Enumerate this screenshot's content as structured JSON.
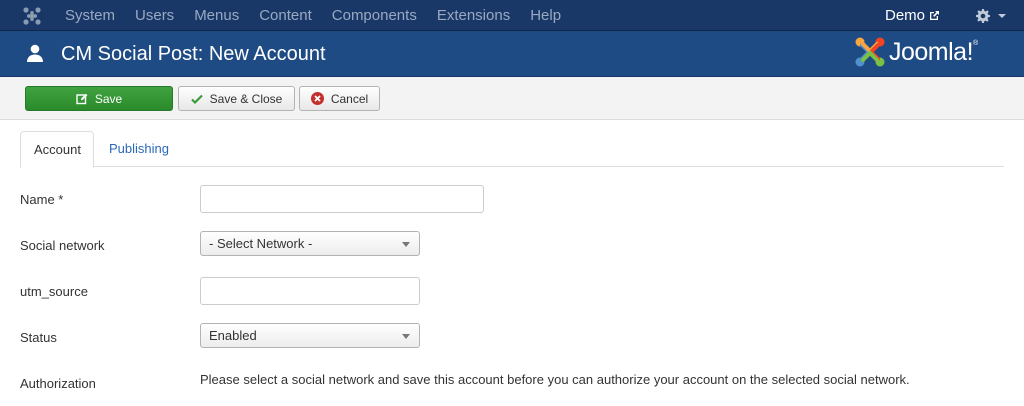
{
  "navbar": {
    "items": [
      "System",
      "Users",
      "Menus",
      "Content",
      "Components",
      "Extensions",
      "Help"
    ],
    "user_link": "Demo"
  },
  "header": {
    "title": "CM Social Post: New Account",
    "brand": "Joomla!"
  },
  "toolbar": {
    "save_label": "Save",
    "save_close_label": "Save & Close",
    "cancel_label": "Cancel"
  },
  "tabs": [
    {
      "label": "Account",
      "active": true
    },
    {
      "label": "Publishing",
      "active": false
    }
  ],
  "form": {
    "name_label": "Name *",
    "name_value": "",
    "social_network_label": "Social network",
    "social_network_value": "- Select Network -",
    "utm_source_label": "utm_source",
    "utm_source_value": "",
    "status_label": "Status",
    "status_value": "Enabled",
    "authorization_label": "Authorization",
    "authorization_text": "Please select a social network and save this account before you can authorize your account on the selected social network."
  },
  "colors": {
    "navbar_bg": "#1a3867",
    "header_bg": "#1f4b85",
    "save_button": "#35963a",
    "link": "#2a69b8"
  },
  "icons": [
    "joomla-logo-icon",
    "external-link-icon",
    "gear-icon",
    "user-icon",
    "edit-icon",
    "check-icon",
    "cancel-circle-icon"
  ]
}
